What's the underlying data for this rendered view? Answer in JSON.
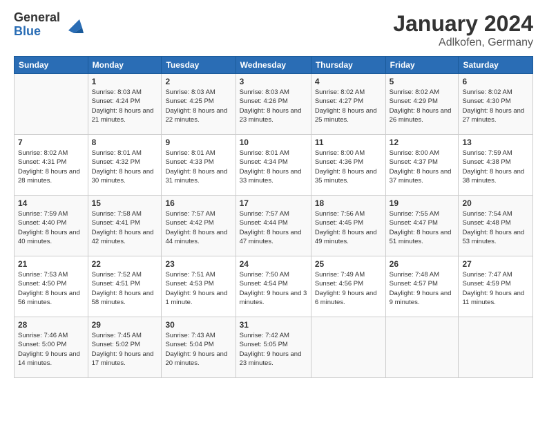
{
  "logo": {
    "general": "General",
    "blue": "Blue"
  },
  "header": {
    "month": "January 2024",
    "location": "Adlkofen, Germany"
  },
  "weekdays": [
    "Sunday",
    "Monday",
    "Tuesday",
    "Wednesday",
    "Thursday",
    "Friday",
    "Saturday"
  ],
  "weeks": [
    [
      {
        "day": "",
        "sunrise": "",
        "sunset": "",
        "daylight": ""
      },
      {
        "day": "1",
        "sunrise": "Sunrise: 8:03 AM",
        "sunset": "Sunset: 4:24 PM",
        "daylight": "Daylight: 8 hours and 21 minutes."
      },
      {
        "day": "2",
        "sunrise": "Sunrise: 8:03 AM",
        "sunset": "Sunset: 4:25 PM",
        "daylight": "Daylight: 8 hours and 22 minutes."
      },
      {
        "day": "3",
        "sunrise": "Sunrise: 8:03 AM",
        "sunset": "Sunset: 4:26 PM",
        "daylight": "Daylight: 8 hours and 23 minutes."
      },
      {
        "day": "4",
        "sunrise": "Sunrise: 8:02 AM",
        "sunset": "Sunset: 4:27 PM",
        "daylight": "Daylight: 8 hours and 25 minutes."
      },
      {
        "day": "5",
        "sunrise": "Sunrise: 8:02 AM",
        "sunset": "Sunset: 4:29 PM",
        "daylight": "Daylight: 8 hours and 26 minutes."
      },
      {
        "day": "6",
        "sunrise": "Sunrise: 8:02 AM",
        "sunset": "Sunset: 4:30 PM",
        "daylight": "Daylight: 8 hours and 27 minutes."
      }
    ],
    [
      {
        "day": "7",
        "sunrise": "Sunrise: 8:02 AM",
        "sunset": "Sunset: 4:31 PM",
        "daylight": "Daylight: 8 hours and 28 minutes."
      },
      {
        "day": "8",
        "sunrise": "Sunrise: 8:01 AM",
        "sunset": "Sunset: 4:32 PM",
        "daylight": "Daylight: 8 hours and 30 minutes."
      },
      {
        "day": "9",
        "sunrise": "Sunrise: 8:01 AM",
        "sunset": "Sunset: 4:33 PM",
        "daylight": "Daylight: 8 hours and 31 minutes."
      },
      {
        "day": "10",
        "sunrise": "Sunrise: 8:01 AM",
        "sunset": "Sunset: 4:34 PM",
        "daylight": "Daylight: 8 hours and 33 minutes."
      },
      {
        "day": "11",
        "sunrise": "Sunrise: 8:00 AM",
        "sunset": "Sunset: 4:36 PM",
        "daylight": "Daylight: 8 hours and 35 minutes."
      },
      {
        "day": "12",
        "sunrise": "Sunrise: 8:00 AM",
        "sunset": "Sunset: 4:37 PM",
        "daylight": "Daylight: 8 hours and 37 minutes."
      },
      {
        "day": "13",
        "sunrise": "Sunrise: 7:59 AM",
        "sunset": "Sunset: 4:38 PM",
        "daylight": "Daylight: 8 hours and 38 minutes."
      }
    ],
    [
      {
        "day": "14",
        "sunrise": "Sunrise: 7:59 AM",
        "sunset": "Sunset: 4:40 PM",
        "daylight": "Daylight: 8 hours and 40 minutes."
      },
      {
        "day": "15",
        "sunrise": "Sunrise: 7:58 AM",
        "sunset": "Sunset: 4:41 PM",
        "daylight": "Daylight: 8 hours and 42 minutes."
      },
      {
        "day": "16",
        "sunrise": "Sunrise: 7:57 AM",
        "sunset": "Sunset: 4:42 PM",
        "daylight": "Daylight: 8 hours and 44 minutes."
      },
      {
        "day": "17",
        "sunrise": "Sunrise: 7:57 AM",
        "sunset": "Sunset: 4:44 PM",
        "daylight": "Daylight: 8 hours and 47 minutes."
      },
      {
        "day": "18",
        "sunrise": "Sunrise: 7:56 AM",
        "sunset": "Sunset: 4:45 PM",
        "daylight": "Daylight: 8 hours and 49 minutes."
      },
      {
        "day": "19",
        "sunrise": "Sunrise: 7:55 AM",
        "sunset": "Sunset: 4:47 PM",
        "daylight": "Daylight: 8 hours and 51 minutes."
      },
      {
        "day": "20",
        "sunrise": "Sunrise: 7:54 AM",
        "sunset": "Sunset: 4:48 PM",
        "daylight": "Daylight: 8 hours and 53 minutes."
      }
    ],
    [
      {
        "day": "21",
        "sunrise": "Sunrise: 7:53 AM",
        "sunset": "Sunset: 4:50 PM",
        "daylight": "Daylight: 8 hours and 56 minutes."
      },
      {
        "day": "22",
        "sunrise": "Sunrise: 7:52 AM",
        "sunset": "Sunset: 4:51 PM",
        "daylight": "Daylight: 8 hours and 58 minutes."
      },
      {
        "day": "23",
        "sunrise": "Sunrise: 7:51 AM",
        "sunset": "Sunset: 4:53 PM",
        "daylight": "Daylight: 9 hours and 1 minute."
      },
      {
        "day": "24",
        "sunrise": "Sunrise: 7:50 AM",
        "sunset": "Sunset: 4:54 PM",
        "daylight": "Daylight: 9 hours and 3 minutes."
      },
      {
        "day": "25",
        "sunrise": "Sunrise: 7:49 AM",
        "sunset": "Sunset: 4:56 PM",
        "daylight": "Daylight: 9 hours and 6 minutes."
      },
      {
        "day": "26",
        "sunrise": "Sunrise: 7:48 AM",
        "sunset": "Sunset: 4:57 PM",
        "daylight": "Daylight: 9 hours and 9 minutes."
      },
      {
        "day": "27",
        "sunrise": "Sunrise: 7:47 AM",
        "sunset": "Sunset: 4:59 PM",
        "daylight": "Daylight: 9 hours and 11 minutes."
      }
    ],
    [
      {
        "day": "28",
        "sunrise": "Sunrise: 7:46 AM",
        "sunset": "Sunset: 5:00 PM",
        "daylight": "Daylight: 9 hours and 14 minutes."
      },
      {
        "day": "29",
        "sunrise": "Sunrise: 7:45 AM",
        "sunset": "Sunset: 5:02 PM",
        "daylight": "Daylight: 9 hours and 17 minutes."
      },
      {
        "day": "30",
        "sunrise": "Sunrise: 7:43 AM",
        "sunset": "Sunset: 5:04 PM",
        "daylight": "Daylight: 9 hours and 20 minutes."
      },
      {
        "day": "31",
        "sunrise": "Sunrise: 7:42 AM",
        "sunset": "Sunset: 5:05 PM",
        "daylight": "Daylight: 9 hours and 23 minutes."
      },
      {
        "day": "",
        "sunrise": "",
        "sunset": "",
        "daylight": ""
      },
      {
        "day": "",
        "sunrise": "",
        "sunset": "",
        "daylight": ""
      },
      {
        "day": "",
        "sunrise": "",
        "sunset": "",
        "daylight": ""
      }
    ]
  ]
}
